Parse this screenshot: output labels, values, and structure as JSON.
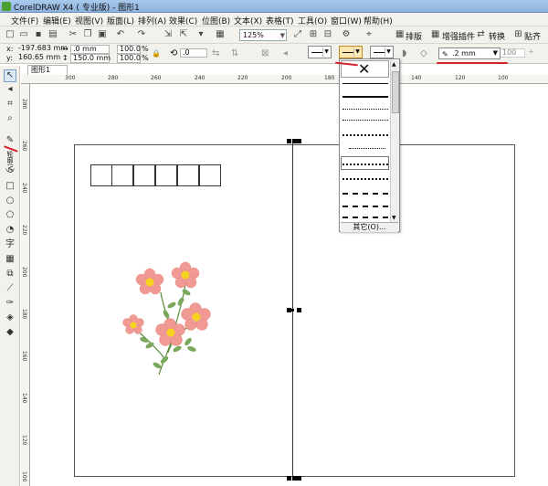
{
  "window": {
    "title": "CorelDRAW X4 ( 专业版) - 图形1"
  },
  "menu": [
    "文件(F)",
    "编辑(E)",
    "视图(V)",
    "版面(L)",
    "排列(A)",
    "效果(C)",
    "位图(B)",
    "文本(X)",
    "表格(T)",
    "工具(O)",
    "窗口(W)",
    "帮助(H)"
  ],
  "toolbar": {
    "zoom": "125%",
    "zoom_dropdown": "▼",
    "buttons": [
      "排版",
      "增强插件",
      "转换",
      "贴齐"
    ]
  },
  "property_bar": {
    "x_label": "x:",
    "x_value": "-197.683 mm",
    "y_label": "y:",
    "y_value": "160.65 mm",
    "w_value": ".0 mm",
    "h_value": "150.0 mm",
    "scale_w": "100.0",
    "scale_h": "100.0",
    "percent": "%",
    "rotation": ".0",
    "outline_width": ".2 mm",
    "extra_value": "100"
  },
  "document": {
    "tab": "图形1"
  },
  "ruler": {
    "h": [
      "300",
      "280",
      "260",
      "240",
      "220",
      "200",
      "180",
      "160",
      "140",
      "120",
      "100"
    ],
    "v": [
      "280",
      "260",
      "240",
      "220",
      "200",
      "180",
      "160",
      "140",
      "120",
      "100"
    ]
  },
  "line_style_dropdown": {
    "other_label": "其它(O)...",
    "none_mark": "✕"
  },
  "toolbox_vertical_label": "轮廓(V)",
  "colors": {
    "flower_petal": "#f19a93",
    "flower_center": "#f5d31f",
    "leaf": "#7aa85a",
    "annotation": "#d4232a"
  }
}
